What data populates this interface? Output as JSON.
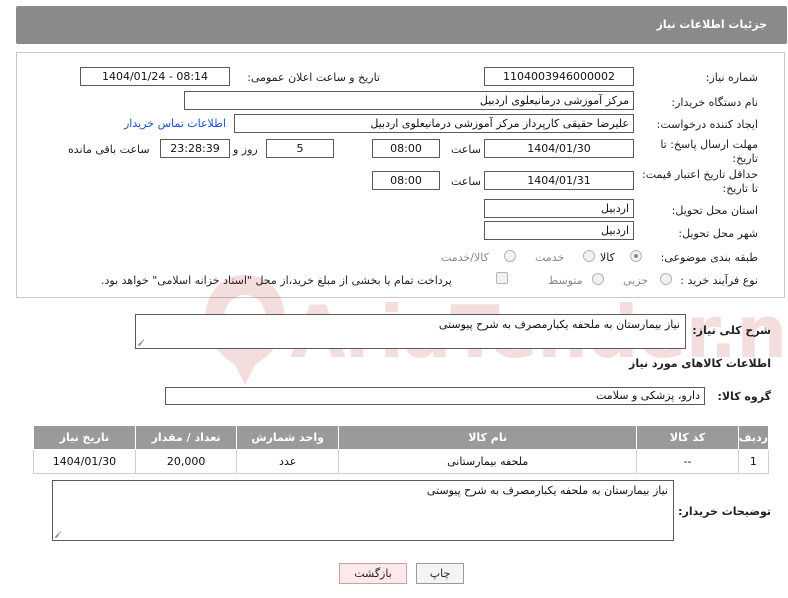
{
  "header": {
    "title": "جزئیات اطلاعات نیاز"
  },
  "form": {
    "need_number": {
      "label": "شماره نیاز:",
      "value": "1104003946000002"
    },
    "announce_datetime": {
      "label": "تاریخ و ساعت اعلان عمومی:",
      "value": "1404/01/24 - 08:14"
    },
    "buyer_org": {
      "label": "نام دستگاه خریدار:",
      "value": "مرکز آموزشی درمانیعلوی اردبیل"
    },
    "requester": {
      "label": "ایجاد کننده درخواست:",
      "value": "علیرضا حقیقی کارپرداز مرکز آموزشی درمانیعلوی اردبیل",
      "link": "اطلاعات تماس خریدار"
    },
    "reply_deadline": {
      "label_line1": "مهلت ارسال پاسخ: تا",
      "label_line2": "تاریخ:",
      "date": "1404/01/30",
      "time_label": "ساعت",
      "time": "08:00",
      "days": "5",
      "days_label": "روز و",
      "remaining": "23:28:39",
      "remaining_label": "ساعت باقی مانده"
    },
    "price_validity": {
      "label_line1": "حداقل تاریخ اعتبار قیمت:",
      "label_line2": "تا تاریخ:",
      "date": "1404/01/31",
      "time_label": "ساعت",
      "time": "08:00"
    },
    "delivery_province": {
      "label": "استان محل تحویل:",
      "value": "اردبیل"
    },
    "delivery_city": {
      "label": "شهر محل تحویل:",
      "value": "اردبیل"
    },
    "category": {
      "label": "طبقه بندی موضوعی:",
      "options": [
        "کالا",
        "خدمت",
        "کالا/خدمت"
      ],
      "selected": "کالا"
    },
    "purchase_process": {
      "label": "نوع فرآیند خرید :",
      "options": [
        "جزیی",
        "متوسط"
      ],
      "note": "پرداخت تمام یا بخشی از مبلغ خرید،از محل \"اسناد خزانه اسلامی\" خواهد بود."
    }
  },
  "description": {
    "label": "شرح کلی نیاز:",
    "value": "نیاز بیمارستان به ملحفه یکبارمصرف به شرح پیوستی"
  },
  "goods_section": {
    "title": "اطلاعات کالاهای مورد نیاز"
  },
  "goods_group": {
    "label": "گروه کالا:",
    "value": "دارو، پزشکی و سلامت"
  },
  "table": {
    "headers": [
      "ردیف",
      "کد کالا",
      "نام کالا",
      "واحد شمارش",
      "تعداد / مقدار",
      "تاریخ نیاز"
    ],
    "rows": [
      [
        "1",
        "--",
        "ملحفه بیمارستانی",
        "عدد",
        "20,000",
        "1404/01/30"
      ]
    ]
  },
  "buyer_notes": {
    "label": "توضیحات خریدار:",
    "value": "نیاز بیمارستان به ملحفه یکبارمصرف به شرح پیوستی"
  },
  "buttons": {
    "print": "چاپ",
    "back": "بازگشت"
  },
  "watermark": {
    "text": "AriaTender.neT"
  },
  "colors": {
    "header_bg": "#8a8a8a",
    "table_header_bg": "#9a9a9a",
    "link": "#1a4ed0",
    "back_button_bg": "#fde8ea"
  }
}
